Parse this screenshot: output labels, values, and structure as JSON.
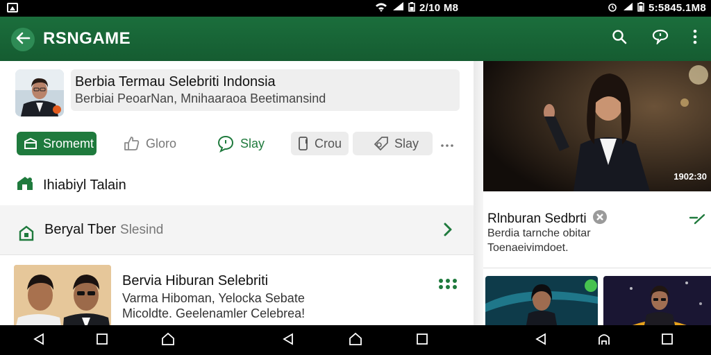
{
  "status_bar": {
    "center_text": "2/10 M8",
    "right_text": "5:5845.1M8"
  },
  "app_bar": {
    "title": "RSNGAME",
    "back_icon": "arrow-left-icon",
    "actions": [
      "search-icon",
      "chat-icon",
      "more-vert-icon"
    ]
  },
  "profile": {
    "title": "Berbia Termau Selebriti Indonsia",
    "subtitle": "Berbiai PeoarNan, Mnihaaraoa Beetimansind"
  },
  "actions": [
    {
      "label": "Sromemt",
      "icon": "folder-icon",
      "style": "primary"
    },
    {
      "label": "Gloro",
      "icon": "thumbs-up-icon",
      "style": "plain"
    },
    {
      "label": "Slay",
      "icon": "chat-bubble-icon",
      "style": "green"
    },
    {
      "label": "Crou",
      "icon": "phone-icon",
      "style": "grey"
    },
    {
      "label": "Slay",
      "icon": "search-tag-icon",
      "style": "grey"
    }
  ],
  "section": {
    "label": "Ihiabiyl Talain",
    "icon": "home-icon"
  },
  "band": {
    "label": "Beryal Tber",
    "sub": "Slesind",
    "icon": "home-outline-icon"
  },
  "news": {
    "title": "Bervia Hiburan Selebriti",
    "sub1": "Varma Hiboman, Yelocka Sebate",
    "sub2": "Micoldte. Geelenamler Celebrea!"
  },
  "right_panel": {
    "hero_time": "1902:30",
    "title": "Rlnburan Sedbrti",
    "sub1": "Berdia tarnche obitar",
    "sub2": "Toenaeivimdoet."
  },
  "colors": {
    "app_bar": "#1b6e3c",
    "accent": "#1f7a3d"
  }
}
